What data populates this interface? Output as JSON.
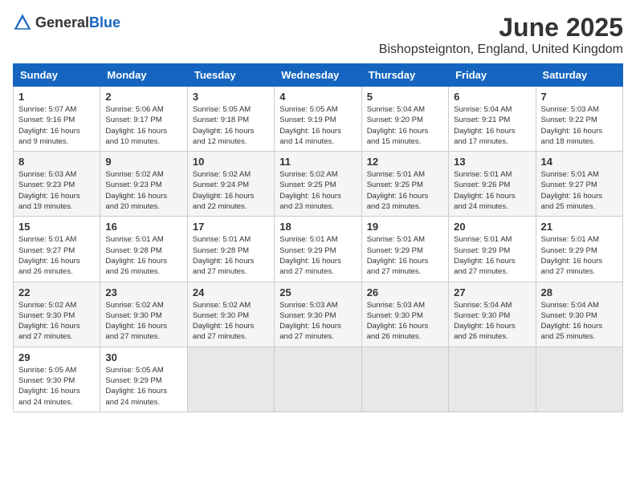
{
  "header": {
    "logo_general": "General",
    "logo_blue": "Blue",
    "month_year": "June 2025",
    "location": "Bishopsteignton, England, United Kingdom"
  },
  "weekdays": [
    "Sunday",
    "Monday",
    "Tuesday",
    "Wednesday",
    "Thursday",
    "Friday",
    "Saturday"
  ],
  "rows": [
    [
      {
        "day": "1",
        "detail": "Sunrise: 5:07 AM\nSunset: 9:16 PM\nDaylight: 16 hours\nand 9 minutes."
      },
      {
        "day": "2",
        "detail": "Sunrise: 5:06 AM\nSunset: 9:17 PM\nDaylight: 16 hours\nand 10 minutes."
      },
      {
        "day": "3",
        "detail": "Sunrise: 5:05 AM\nSunset: 9:18 PM\nDaylight: 16 hours\nand 12 minutes."
      },
      {
        "day": "4",
        "detail": "Sunrise: 5:05 AM\nSunset: 9:19 PM\nDaylight: 16 hours\nand 14 minutes."
      },
      {
        "day": "5",
        "detail": "Sunrise: 5:04 AM\nSunset: 9:20 PM\nDaylight: 16 hours\nand 15 minutes."
      },
      {
        "day": "6",
        "detail": "Sunrise: 5:04 AM\nSunset: 9:21 PM\nDaylight: 16 hours\nand 17 minutes."
      },
      {
        "day": "7",
        "detail": "Sunrise: 5:03 AM\nSunset: 9:22 PM\nDaylight: 16 hours\nand 18 minutes."
      }
    ],
    [
      {
        "day": "8",
        "detail": "Sunrise: 5:03 AM\nSunset: 9:23 PM\nDaylight: 16 hours\nand 19 minutes."
      },
      {
        "day": "9",
        "detail": "Sunrise: 5:02 AM\nSunset: 9:23 PM\nDaylight: 16 hours\nand 20 minutes."
      },
      {
        "day": "10",
        "detail": "Sunrise: 5:02 AM\nSunset: 9:24 PM\nDaylight: 16 hours\nand 22 minutes."
      },
      {
        "day": "11",
        "detail": "Sunrise: 5:02 AM\nSunset: 9:25 PM\nDaylight: 16 hours\nand 23 minutes."
      },
      {
        "day": "12",
        "detail": "Sunrise: 5:01 AM\nSunset: 9:25 PM\nDaylight: 16 hours\nand 23 minutes."
      },
      {
        "day": "13",
        "detail": "Sunrise: 5:01 AM\nSunset: 9:26 PM\nDaylight: 16 hours\nand 24 minutes."
      },
      {
        "day": "14",
        "detail": "Sunrise: 5:01 AM\nSunset: 9:27 PM\nDaylight: 16 hours\nand 25 minutes."
      }
    ],
    [
      {
        "day": "15",
        "detail": "Sunrise: 5:01 AM\nSunset: 9:27 PM\nDaylight: 16 hours\nand 26 minutes."
      },
      {
        "day": "16",
        "detail": "Sunrise: 5:01 AM\nSunset: 9:28 PM\nDaylight: 16 hours\nand 26 minutes."
      },
      {
        "day": "17",
        "detail": "Sunrise: 5:01 AM\nSunset: 9:28 PM\nDaylight: 16 hours\nand 27 minutes."
      },
      {
        "day": "18",
        "detail": "Sunrise: 5:01 AM\nSunset: 9:29 PM\nDaylight: 16 hours\nand 27 minutes."
      },
      {
        "day": "19",
        "detail": "Sunrise: 5:01 AM\nSunset: 9:29 PM\nDaylight: 16 hours\nand 27 minutes."
      },
      {
        "day": "20",
        "detail": "Sunrise: 5:01 AM\nSunset: 9:29 PM\nDaylight: 16 hours\nand 27 minutes."
      },
      {
        "day": "21",
        "detail": "Sunrise: 5:01 AM\nSunset: 9:29 PM\nDaylight: 16 hours\nand 27 minutes."
      }
    ],
    [
      {
        "day": "22",
        "detail": "Sunrise: 5:02 AM\nSunset: 9:30 PM\nDaylight: 16 hours\nand 27 minutes."
      },
      {
        "day": "23",
        "detail": "Sunrise: 5:02 AM\nSunset: 9:30 PM\nDaylight: 16 hours\nand 27 minutes."
      },
      {
        "day": "24",
        "detail": "Sunrise: 5:02 AM\nSunset: 9:30 PM\nDaylight: 16 hours\nand 27 minutes."
      },
      {
        "day": "25",
        "detail": "Sunrise: 5:03 AM\nSunset: 9:30 PM\nDaylight: 16 hours\nand 27 minutes."
      },
      {
        "day": "26",
        "detail": "Sunrise: 5:03 AM\nSunset: 9:30 PM\nDaylight: 16 hours\nand 26 minutes."
      },
      {
        "day": "27",
        "detail": "Sunrise: 5:04 AM\nSunset: 9:30 PM\nDaylight: 16 hours\nand 26 minutes."
      },
      {
        "day": "28",
        "detail": "Sunrise: 5:04 AM\nSunset: 9:30 PM\nDaylight: 16 hours\nand 25 minutes."
      }
    ],
    [
      {
        "day": "29",
        "detail": "Sunrise: 5:05 AM\nSunset: 9:30 PM\nDaylight: 16 hours\nand 24 minutes."
      },
      {
        "day": "30",
        "detail": "Sunrise: 5:05 AM\nSunset: 9:29 PM\nDaylight: 16 hours\nand 24 minutes."
      },
      {
        "day": "",
        "detail": ""
      },
      {
        "day": "",
        "detail": ""
      },
      {
        "day": "",
        "detail": ""
      },
      {
        "day": "",
        "detail": ""
      },
      {
        "day": "",
        "detail": ""
      }
    ]
  ]
}
